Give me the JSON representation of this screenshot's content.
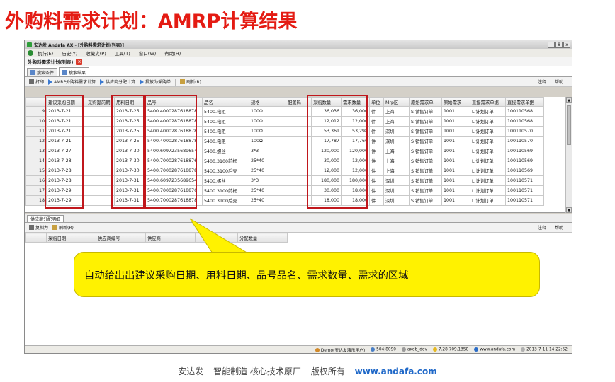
{
  "slide": {
    "title": "外购料需求计划：AMRP计算结果",
    "callout": "自动给出出建议采购日期、用料日期、品号品名、需求数量、需求的区域",
    "footer_company": "安达发",
    "footer_tagline": "智能制造 核心技术原厂",
    "footer_rights": "版权所有",
    "footer_url": "www.andafa.com"
  },
  "window": {
    "title": "安达发 Andafa AX - [外购料需求计划(列表)]",
    "controls": [
      "_",
      "8",
      "x"
    ]
  },
  "menu": [
    "执行(E)",
    "历史(Y)",
    "收藏夹(P)",
    "工具(T)",
    "窗口(W)",
    "帮助(H)"
  ],
  "subtitle": "外购料需求计划(列表)",
  "tabs": [
    "搜索条件",
    "搜索结果"
  ],
  "toolbar": {
    "print": "打印",
    "amrp_calc": "AMRP外购料需求计算",
    "supplier_alloc": "供应商分配计算",
    "to_purchase": "投放为采购单",
    "refresh": "刷新(R)",
    "annotate": "注释",
    "help": "帮助"
  },
  "grid": {
    "columns": [
      "建议采购日期",
      "采购提前期",
      "用料日期",
      "品号",
      "品名",
      "规格",
      "配置码",
      "采购数量",
      "需求数量",
      "单位",
      "Mrp区",
      "原始需求单",
      "原始需求",
      "直接需求单据",
      "直接需求单据"
    ],
    "rows": [
      {
        "n": "9",
        "buy": "2013-7-21",
        "lead": "",
        "use": "2013-7-25",
        "item": "5400.4000287618878",
        "name": "5400.电阻",
        "spec": "100Ω",
        "cfg": "",
        "qty": "36,036",
        "need": "36,000",
        "unit": "件",
        "area": "上海",
        "src": "S 销售订单",
        "srcno": "1001",
        "direct": "L 计划订单",
        "directno": "100110568"
      },
      {
        "n": "10",
        "buy": "2013-7-21",
        "lead": "",
        "use": "2013-7-25",
        "item": "5400.4000287618878",
        "name": "5400.电阻",
        "spec": "100Ω",
        "cfg": "",
        "qty": "12,012",
        "need": "12,000",
        "unit": "件",
        "area": "上海",
        "src": "S 销售订单",
        "srcno": "1001",
        "direct": "L 计划订单",
        "directno": "100110568"
      },
      {
        "n": "11",
        "buy": "2013-7-21",
        "lead": "",
        "use": "2013-7-25",
        "item": "5400.4000287618878",
        "name": "5400.电阻",
        "spec": "100Ω",
        "cfg": "",
        "qty": "53,361",
        "need": "53,298",
        "unit": "件",
        "area": "深圳",
        "src": "S 销售订单",
        "srcno": "1001",
        "direct": "L 计划订单",
        "directno": "100110570"
      },
      {
        "n": "12",
        "buy": "2013-7-21",
        "lead": "",
        "use": "2013-7-25",
        "item": "5400.4000287618878",
        "name": "5400.电阻",
        "spec": "100Ω",
        "cfg": "",
        "qty": "17,787",
        "need": "17,766",
        "unit": "件",
        "area": "深圳",
        "src": "S 销售订单",
        "srcno": "1001",
        "direct": "L 计划订单",
        "directno": "100110570"
      },
      {
        "n": "13",
        "buy": "2013-7-27",
        "lead": "",
        "use": "2013-7-30",
        "item": "5400.6097235689654",
        "name": "5400.螺丝",
        "spec": "3*3",
        "cfg": "",
        "qty": "120,000",
        "need": "120,000",
        "unit": "件",
        "area": "上海",
        "src": "S 销售订单",
        "srcno": "1001",
        "direct": "L 计划订单",
        "directno": "100110569"
      },
      {
        "n": "14",
        "buy": "2013-7-28",
        "lead": "",
        "use": "2013-7-30",
        "item": "5400.7000287618876",
        "name": "5400.3100前框",
        "spec": "25*40",
        "cfg": "",
        "qty": "30,000",
        "need": "12,000",
        "unit": "件",
        "area": "上海",
        "src": "S 销售订单",
        "srcno": "1001",
        "direct": "L 计划订单",
        "directno": "100110569"
      },
      {
        "n": "15",
        "buy": "2013-7-28",
        "lead": "",
        "use": "2013-7-30",
        "item": "5400.7000287618878",
        "name": "5400.3100后壳",
        "spec": "25*40",
        "cfg": "",
        "qty": "12,000",
        "need": "12,000",
        "unit": "件",
        "area": "上海",
        "src": "S 销售订单",
        "srcno": "1001",
        "direct": "L 计划订单",
        "directno": "100110569"
      },
      {
        "n": "16",
        "buy": "2013-7-28",
        "lead": "",
        "use": "2013-7-31",
        "item": "5400.6097235689654",
        "name": "5400.螺丝",
        "spec": "3*3",
        "cfg": "",
        "qty": "180,000",
        "need": "180,000",
        "unit": "件",
        "area": "深圳",
        "src": "S 销售订单",
        "srcno": "1001",
        "direct": "L 计划订单",
        "directno": "100110571"
      },
      {
        "n": "17",
        "buy": "2013-7-29",
        "lead": "",
        "use": "2013-7-31",
        "item": "5400.7000287618876",
        "name": "5400.3100前框",
        "spec": "25*40",
        "cfg": "",
        "qty": "30,000",
        "need": "18,000",
        "unit": "件",
        "area": "深圳",
        "src": "S 销售订单",
        "srcno": "1001",
        "direct": "L 计划订单",
        "directno": "100110571"
      },
      {
        "n": "18",
        "buy": "2013-7-29",
        "lead": "",
        "use": "2013-7-31",
        "item": "5400.7000287618878",
        "name": "5400.3100后壳",
        "spec": "25*40",
        "cfg": "",
        "qty": "18,000",
        "need": "18,000",
        "unit": "件",
        "area": "深圳",
        "src": "S 销售订单",
        "srcno": "1001",
        "direct": "L 计划订单",
        "directno": "100110571"
      }
    ]
  },
  "lower": {
    "tab": "供应商分配明细",
    "copy": "复制为",
    "refresh": "刷新(R)",
    "annotate": "注释",
    "help": "帮助",
    "columns": [
      "采购日期",
      "供应商编号",
      "供应商",
      "",
      "分配数量"
    ]
  },
  "status": {
    "user": "Demo(安达发演示用户)",
    "port": "504:8090",
    "db": "axdb_dev",
    "version": "7.28.709.1358",
    "site": "www.andafa.com",
    "datetime": "2013-7-11 14:22:52"
  },
  "colors": {
    "title_red": "#e41b13",
    "highlight_red": "#c0171c",
    "callout_yellow": "#fff200",
    "link_blue": "#1f68c8"
  }
}
